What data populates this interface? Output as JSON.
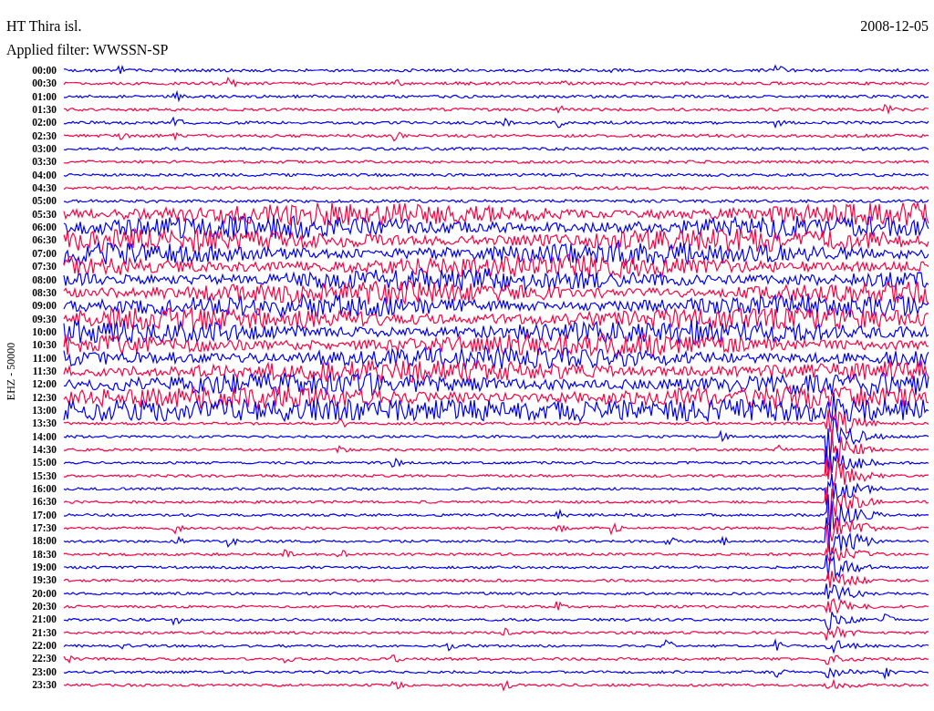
{
  "title": "HT Thira isl.",
  "date": "2008-12-05",
  "filter": "Applied filter: WWSSN-SP",
  "axis_label": "EHZ - 50000",
  "rows": [
    {
      "time": "00:00",
      "color": "#0000ff"
    },
    {
      "time": "00:30",
      "color": "#ff0040"
    },
    {
      "time": "01:00",
      "color": "#0000ff"
    },
    {
      "time": "01:30",
      "color": "#ff0040"
    },
    {
      "time": "02:00",
      "color": "#0000ff"
    },
    {
      "time": "02:30",
      "color": "#ff0040"
    },
    {
      "time": "03:00",
      "color": "#0000ff"
    },
    {
      "time": "03:30",
      "color": "#ff0040"
    },
    {
      "time": "04:00",
      "color": "#0000ff"
    },
    {
      "time": "04:30",
      "color": "#ff0040"
    },
    {
      "time": "05:00",
      "color": "#0000ff"
    },
    {
      "time": "05:30",
      "color": "#ff0040"
    },
    {
      "time": "06:00",
      "color": "#0000ff"
    },
    {
      "time": "06:30",
      "color": "#ff0040"
    },
    {
      "time": "07:00",
      "color": "#0000ff"
    },
    {
      "time": "07:30",
      "color": "#ff0040"
    },
    {
      "time": "08:00",
      "color": "#0000ff"
    },
    {
      "time": "08:30",
      "color": "#ff0040"
    },
    {
      "time": "09:00",
      "color": "#0000ff"
    },
    {
      "time": "09:30",
      "color": "#ff0040"
    },
    {
      "time": "10:00",
      "color": "#0000ff"
    },
    {
      "time": "10:30",
      "color": "#ff0040"
    },
    {
      "time": "11:00",
      "color": "#0000ff"
    },
    {
      "time": "11:30",
      "color": "#ff0040"
    },
    {
      "time": "12:00",
      "color": "#0000ff"
    },
    {
      "time": "12:30",
      "color": "#ff0040"
    },
    {
      "time": "13:00",
      "color": "#0000ff"
    },
    {
      "time": "13:30",
      "color": "#ff0040"
    },
    {
      "time": "14:00",
      "color": "#0000ff"
    },
    {
      "time": "14:30",
      "color": "#ff0040"
    },
    {
      "time": "15:00",
      "color": "#0000ff"
    },
    {
      "time": "15:30",
      "color": "#ff0040"
    },
    {
      "time": "16:00",
      "color": "#0000ff"
    },
    {
      "time": "16:30",
      "color": "#ff0040"
    },
    {
      "time": "17:00",
      "color": "#0000ff"
    },
    {
      "time": "17:30",
      "color": "#ff0040"
    },
    {
      "time": "18:00",
      "color": "#0000ff"
    },
    {
      "time": "18:30",
      "color": "#ff0040"
    },
    {
      "time": "19:00",
      "color": "#0000ff"
    },
    {
      "time": "19:30",
      "color": "#ff0040"
    },
    {
      "time": "20:00",
      "color": "#0000ff"
    },
    {
      "time": "20:30",
      "color": "#ff0040"
    },
    {
      "time": "21:00",
      "color": "#0000ff"
    },
    {
      "time": "21:30",
      "color": "#ff0040"
    },
    {
      "time": "22:00",
      "color": "#0000ff"
    },
    {
      "time": "22:30",
      "color": "#ff0040"
    },
    {
      "time": "23:00",
      "color": "#0000ff"
    },
    {
      "time": "23:30",
      "color": "#ff0040"
    }
  ]
}
